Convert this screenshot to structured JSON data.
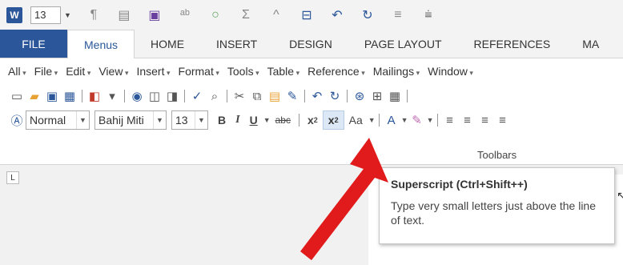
{
  "qat": {
    "app_icon": "W",
    "font_size": "13"
  },
  "tabs": {
    "file": "FILE",
    "items": [
      "Menus",
      "HOME",
      "INSERT",
      "DESIGN",
      "PAGE LAYOUT",
      "REFERENCES",
      "MA"
    ]
  },
  "menus": [
    "All",
    "File",
    "Edit",
    "View",
    "Insert",
    "Format",
    "Tools",
    "Table",
    "Reference",
    "Mailings",
    "Window"
  ],
  "format_row": {
    "style": "Normal",
    "font": "Bahij Miti",
    "size": "13",
    "bold": "B",
    "italic": "I",
    "underline": "U",
    "strike": "abc",
    "subscript": "x",
    "subscript_mark": "2",
    "superscript": "x",
    "superscript_mark": "2",
    "change_case": "Aa"
  },
  "group_label": "Toolbars",
  "tooltip": {
    "title": "Superscript (Ctrl+Shift++)",
    "description": "Type very small letters just above the line of text."
  },
  "colors": {
    "accent": "#2b579a",
    "arrow": "#e11b1b"
  }
}
